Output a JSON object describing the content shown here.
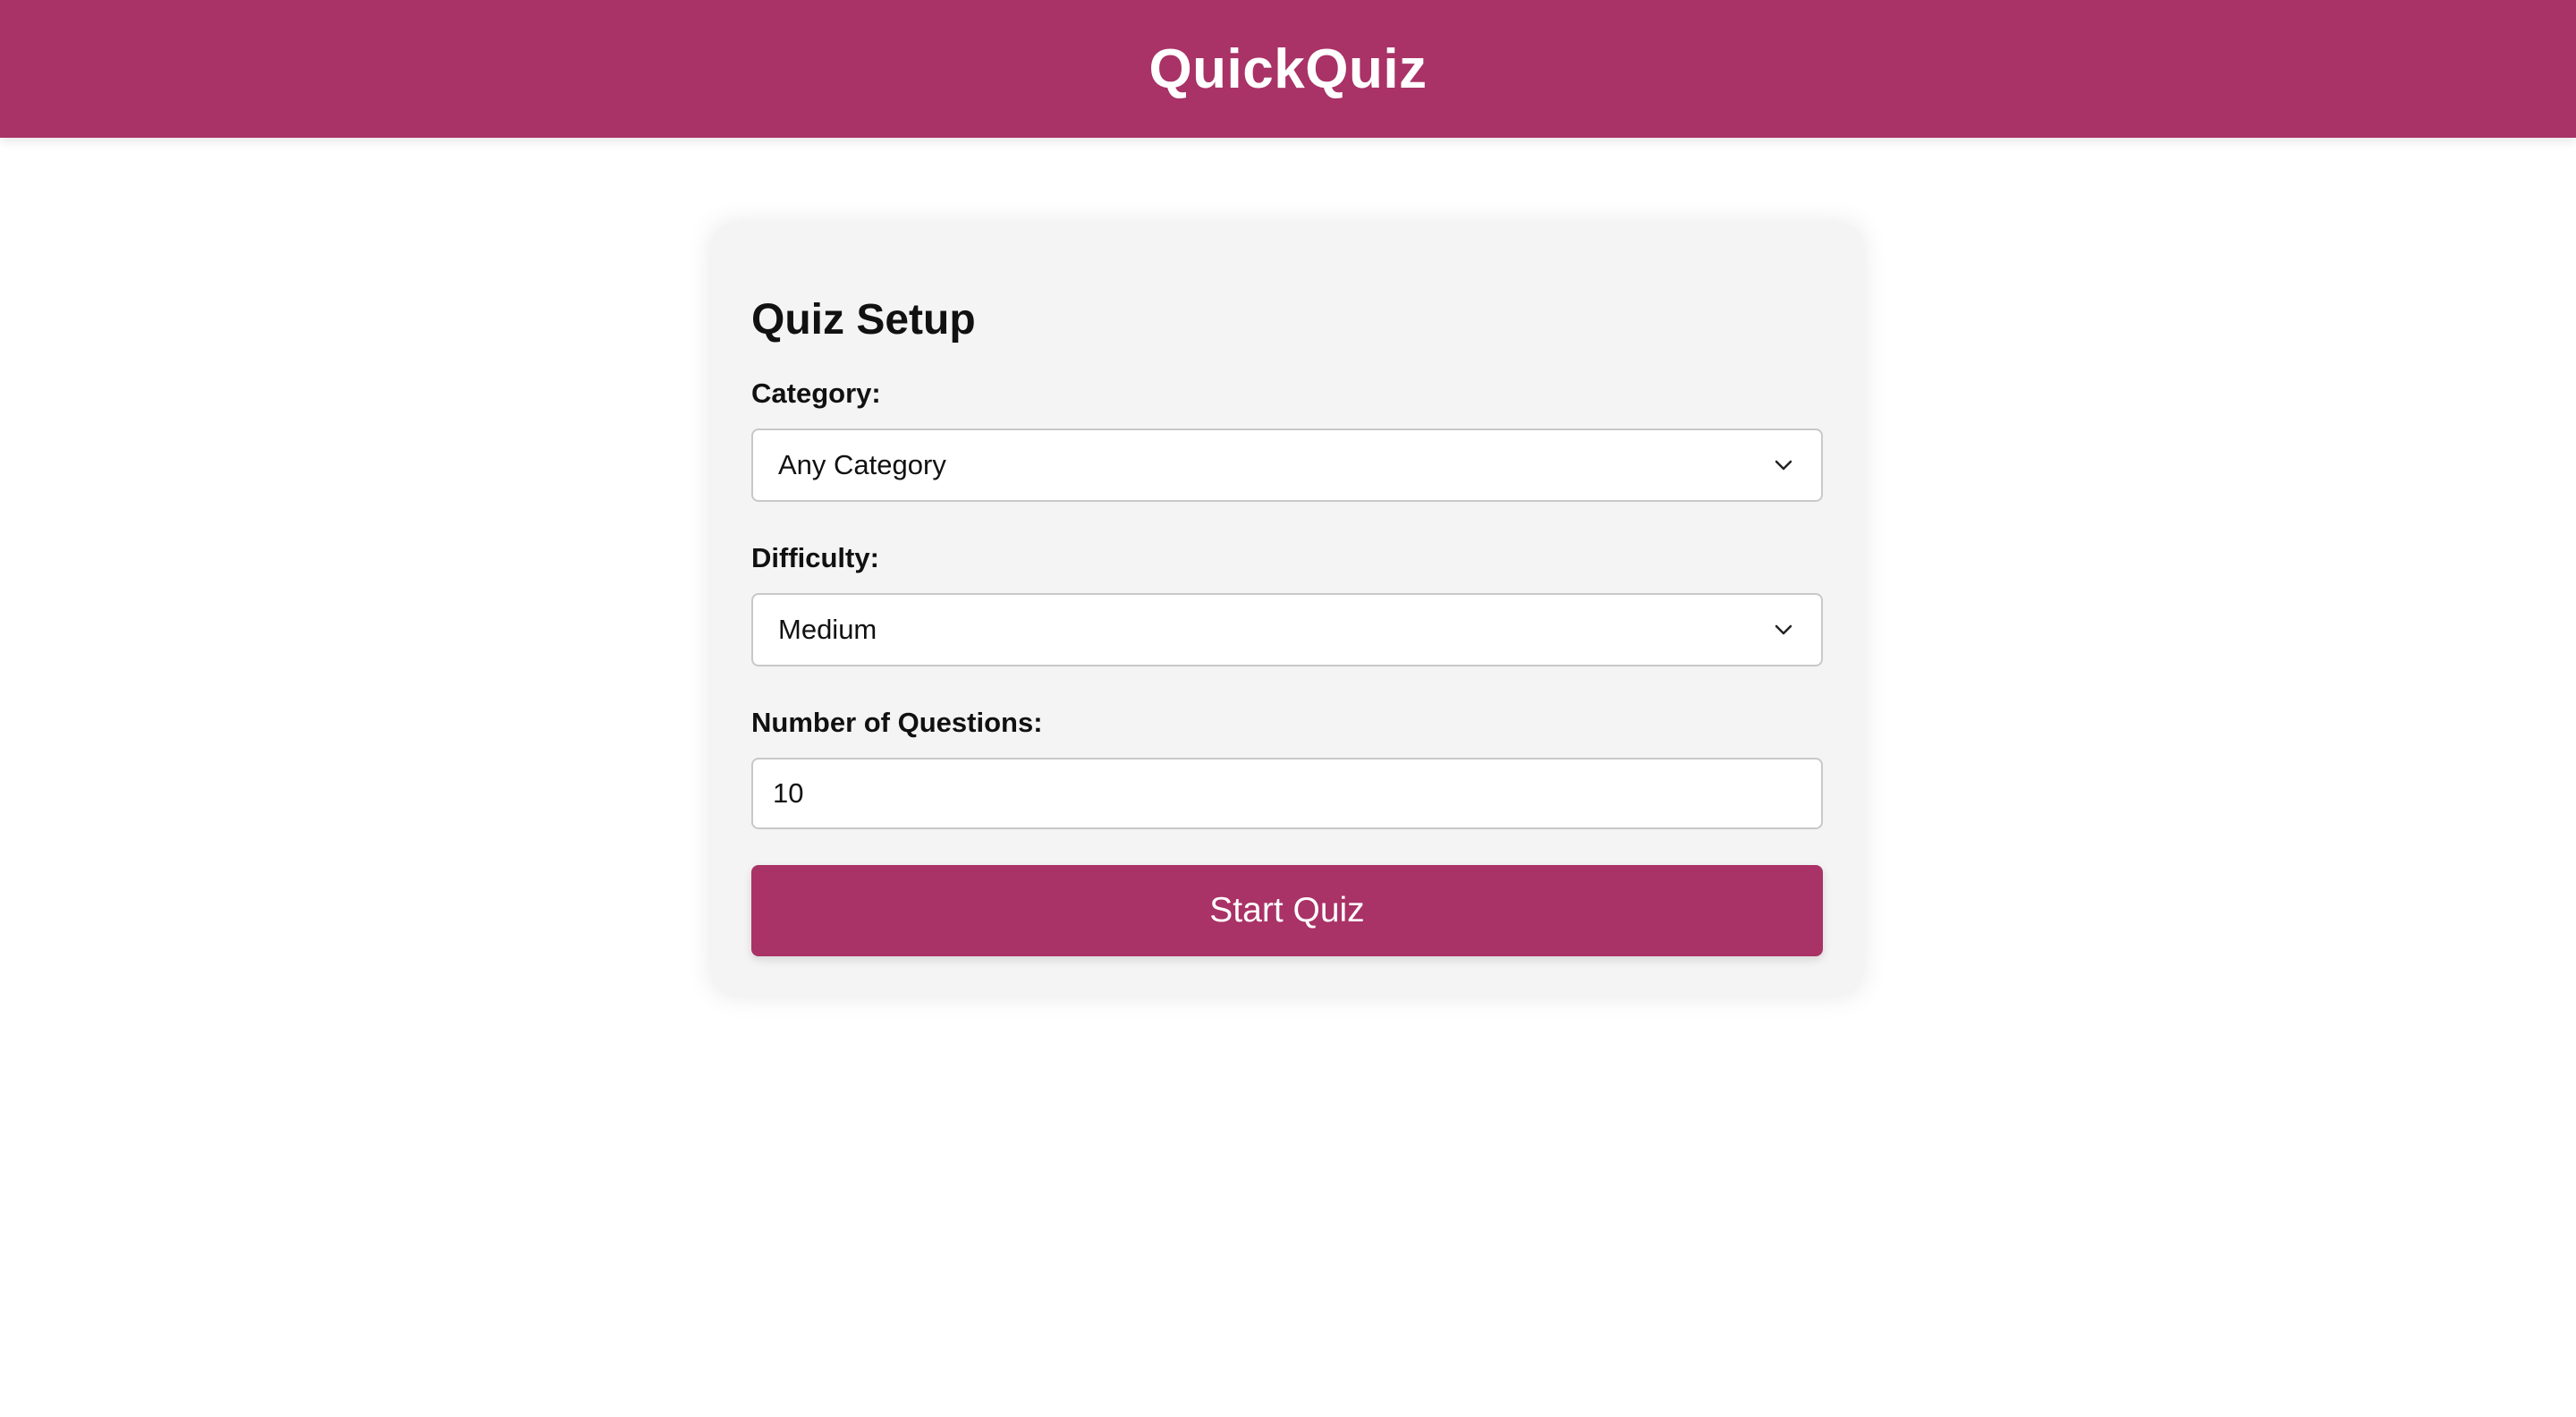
{
  "header": {
    "title": "QuickQuiz"
  },
  "setup": {
    "title": "Quiz Setup",
    "category": {
      "label": "Category:",
      "selected": "Any Category"
    },
    "difficulty": {
      "label": "Difficulty:",
      "selected": "Medium"
    },
    "question_count": {
      "label": "Number of Questions:",
      "value": "10"
    },
    "start_button_label": "Start Quiz"
  },
  "icons": {
    "category_chevron": "chevron-down-icon",
    "difficulty_chevron": "chevron-down-icon"
  },
  "colors": {
    "brand": "#a93266",
    "card_background": "#f4f4f4",
    "header_text": "#ffffff"
  }
}
